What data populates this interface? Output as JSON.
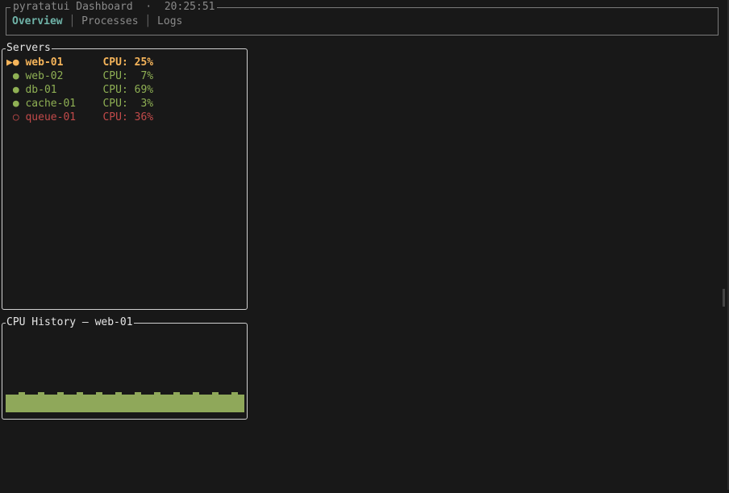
{
  "header": {
    "title": "pyratatui Dashboard",
    "separator": "·",
    "time": "20:25:51",
    "tabs": [
      {
        "label": "Overview",
        "active": true
      },
      {
        "label": "Processes",
        "active": false
      },
      {
        "label": "Logs",
        "active": false
      }
    ]
  },
  "servers": {
    "title": "Servers",
    "selected_marker": "▶",
    "items": [
      {
        "name": "web-01",
        "status_icon": "●",
        "cpu": "CPU: 25%",
        "state": "selected"
      },
      {
        "name": "web-02",
        "status_icon": "●",
        "cpu": "CPU:  7%",
        "state": "online"
      },
      {
        "name": "db-01",
        "status_icon": "●",
        "cpu": "CPU: 69%",
        "state": "online"
      },
      {
        "name": "cache-01",
        "status_icon": "●",
        "cpu": "CPU:  3%",
        "state": "online"
      },
      {
        "name": "queue-01",
        "status_icon": "○",
        "cpu": "CPU: 36%",
        "state": "offline"
      }
    ]
  },
  "history": {
    "title": "CPU History — web-01",
    "max": 100,
    "values": [
      25,
      25,
      28,
      25,
      25,
      28,
      25,
      25,
      28,
      25,
      25,
      28,
      25,
      25,
      28,
      25,
      25,
      28,
      25,
      25,
      28,
      25,
      25,
      28,
      25,
      25,
      28,
      25,
      25,
      28,
      25,
      25,
      28,
      25,
      25,
      28,
      25
    ]
  },
  "colors": {
    "selected": "#f5b45a",
    "online": "#8fb054",
    "offline": "#c24a4a",
    "accent": "#6fb3a8",
    "spark": "#8fa85a"
  }
}
